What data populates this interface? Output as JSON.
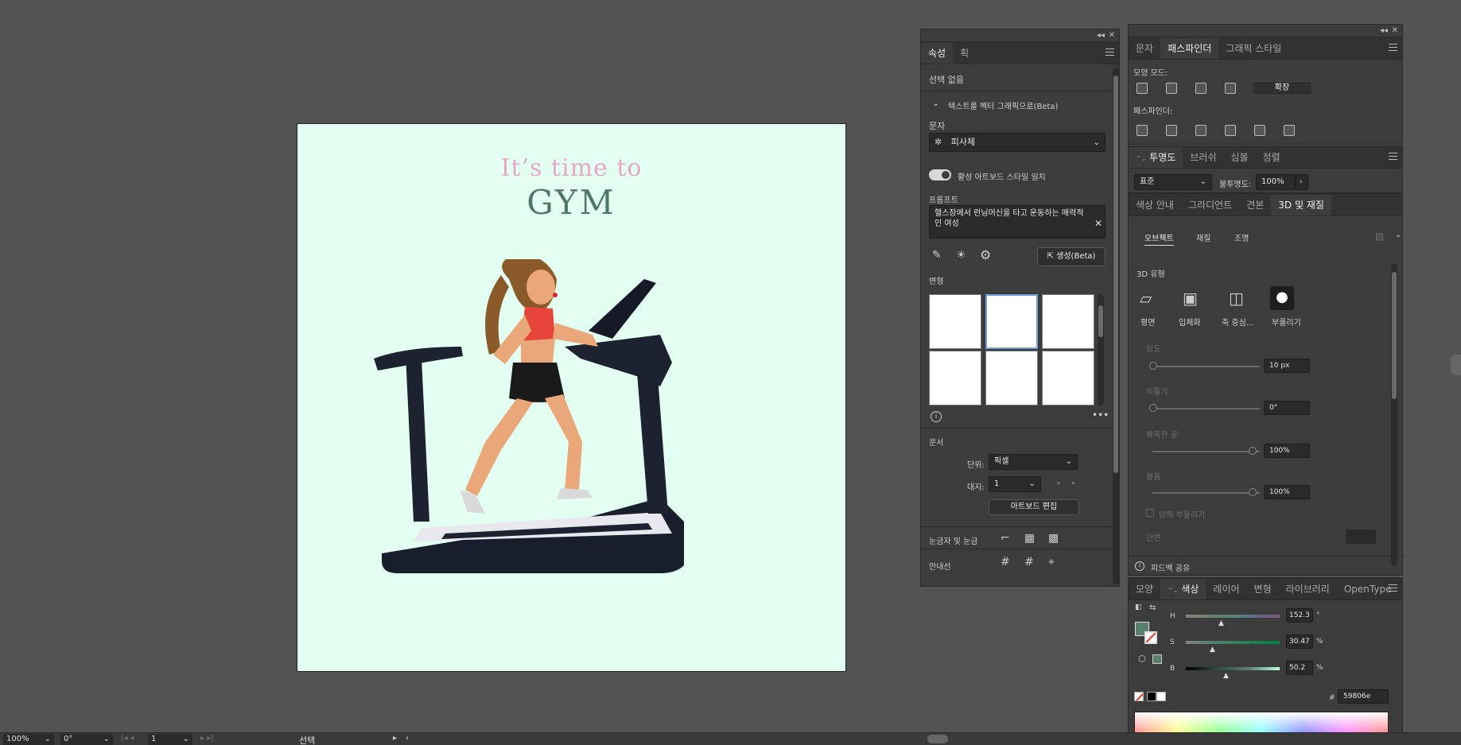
{
  "artboard": {
    "line1": "It’s time to",
    "line2": "GYM"
  },
  "props": {
    "tabs": [
      "속성",
      "획"
    ],
    "no_selection": "선택 없음",
    "section_gen": "텍스트를 벡터 그래픽으로(Beta)",
    "subject_label": "문자",
    "subject_value": "피사체",
    "toggle_label": "활성 아트보드 스타일 일치",
    "prompt_label": "프롬프트",
    "prompt_text": "헬스장에서 런닝머신을 타고 운동하는 매력적인 여성",
    "generate": "생성(Beta)",
    "variations_label": "변형",
    "doc_label": "문서",
    "units_label": "단위:",
    "units_value": "픽셀",
    "artboard_label": "대지:",
    "artboard_value": "1",
    "edit_artboards": "아트보드 편집",
    "rulers_label": "눈금자 및 눈금",
    "guides_label": "안내선"
  },
  "pathfinder": {
    "tabs": [
      "문자",
      "패스파인더",
      "그래픽 스타일"
    ],
    "shape_modes": "모양 모드:",
    "expand": "확장",
    "pathfinders": "패스파인더:"
  },
  "transparency": {
    "tabs": [
      "투명도",
      "브러쉬",
      "심볼",
      "정렬"
    ],
    "mode": "표준",
    "opacity_label": "불투명도:",
    "opacity_value": "100%"
  },
  "threed": {
    "tabs": [
      "색상 안내",
      "그라디언트",
      "견본",
      "3D 및 재질"
    ],
    "subtabs": [
      "오브젝트",
      "재질",
      "조명"
    ],
    "type_label": "3D 유형",
    "types": [
      "평면",
      "입체화",
      "축 중심...",
      "부풀리기"
    ],
    "depth_label": "심도",
    "depth_value": "10 px",
    "twist_label": "비틀기",
    "twist_value": "0°",
    "taper_label": "뾰족한 끝",
    "taper_value": "100%",
    "volume_label": "볼륨",
    "volume_value": "100%",
    "both_sides": "양쪽 부풀리기",
    "bevel_label": "단면",
    "feedback": "피드백 공유"
  },
  "color": {
    "tabs": [
      "모양",
      "색상",
      "레이어",
      "변형",
      "라이브러리",
      "OpenType"
    ],
    "h_label": "H",
    "h_value": "152.3",
    "h_unit": "°",
    "s_label": "S",
    "s_value": "30.47",
    "s_unit": "%",
    "b_label": "B",
    "b_value": "50.2",
    "b_unit": "%",
    "hex": "59806e",
    "fill_color": "#59806e"
  },
  "status": {
    "zoom": "100%",
    "rotate": "0°",
    "artboard": "1",
    "tool": "선택"
  }
}
